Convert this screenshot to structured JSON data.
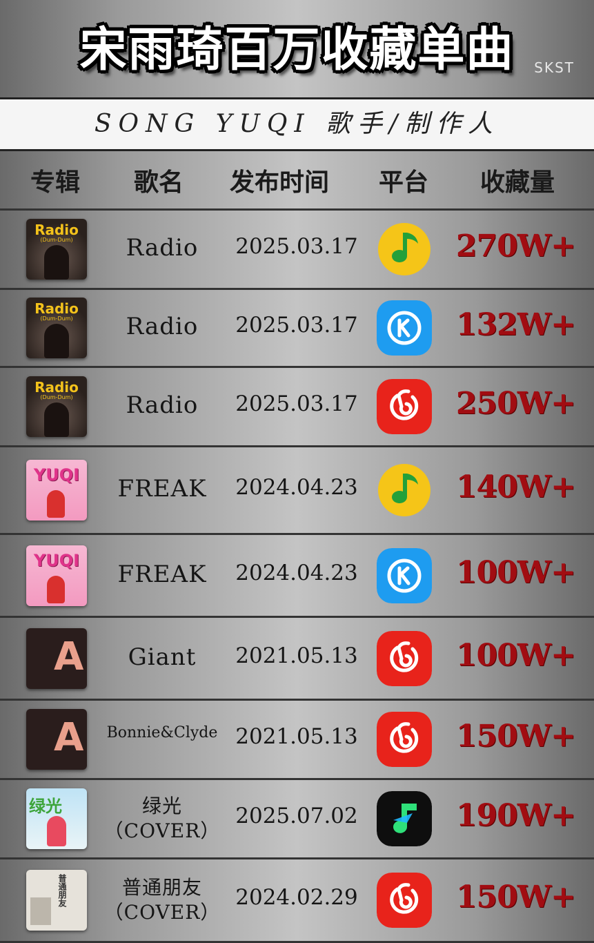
{
  "title": "宋雨琦百万收藏单曲",
  "tag": "SKST",
  "subtitle": "SONG YUQI 歌手/制作人",
  "headers": {
    "album": "专辑",
    "song": "歌名",
    "date": "发布时间",
    "platform": "平台",
    "count": "收藏量"
  },
  "rows": [
    {
      "song": "Radio",
      "date": "2025.03.17",
      "platform": "qq-music-icon",
      "count": "270W+",
      "cover": "radio-cover",
      "cover_title": "Radio",
      "cover_sub": "(Dum-Dum)"
    },
    {
      "song": "Radio",
      "date": "2025.03.17",
      "platform": "kugou-icon",
      "count": "132W+",
      "cover": "radio-cover",
      "cover_title": "Radio",
      "cover_sub": "(Dum-Dum)"
    },
    {
      "song": "Radio",
      "date": "2025.03.17",
      "platform": "netease-icon",
      "count": "250W+",
      "cover": "radio-cover",
      "cover_title": "Radio",
      "cover_sub": "(Dum-Dum)"
    },
    {
      "song": "FREAK",
      "date": "2024.04.23",
      "platform": "qq-music-icon",
      "count": "140W+",
      "cover": "freak-cover",
      "cover_title": "YUQI"
    },
    {
      "song": "FREAK",
      "date": "2024.04.23",
      "platform": "kugou-icon",
      "count": "100W+",
      "cover": "freak-cover",
      "cover_title": "YUQI"
    },
    {
      "song": "Giant",
      "date": "2021.05.13",
      "platform": "netease-icon",
      "count": "100W+",
      "cover": "a-page-cover",
      "cover_title": "A"
    },
    {
      "song": "Bonnie&Clyde",
      "date": "2021.05.13",
      "platform": "netease-icon",
      "count": "150W+",
      "cover": "a-page-cover",
      "cover_title": "A"
    },
    {
      "song": "绿光",
      "song2": "（COVER）",
      "date": "2025.07.02",
      "platform": "qishui-icon",
      "count": "190W+",
      "cover": "green-cover",
      "cover_title": "绿光"
    },
    {
      "song": "普通朋友",
      "song2": "（COVER）",
      "date": "2024.02.29",
      "platform": "netease-icon",
      "count": "150W+",
      "cover": "friend-cover",
      "cover_title": "普通朋友"
    }
  ],
  "colors": {
    "accent": "#a10d12",
    "qq": "#f5c518",
    "kugou": "#1e9cf0",
    "netease": "#e8231b",
    "qishui": "#0e0e0e"
  }
}
